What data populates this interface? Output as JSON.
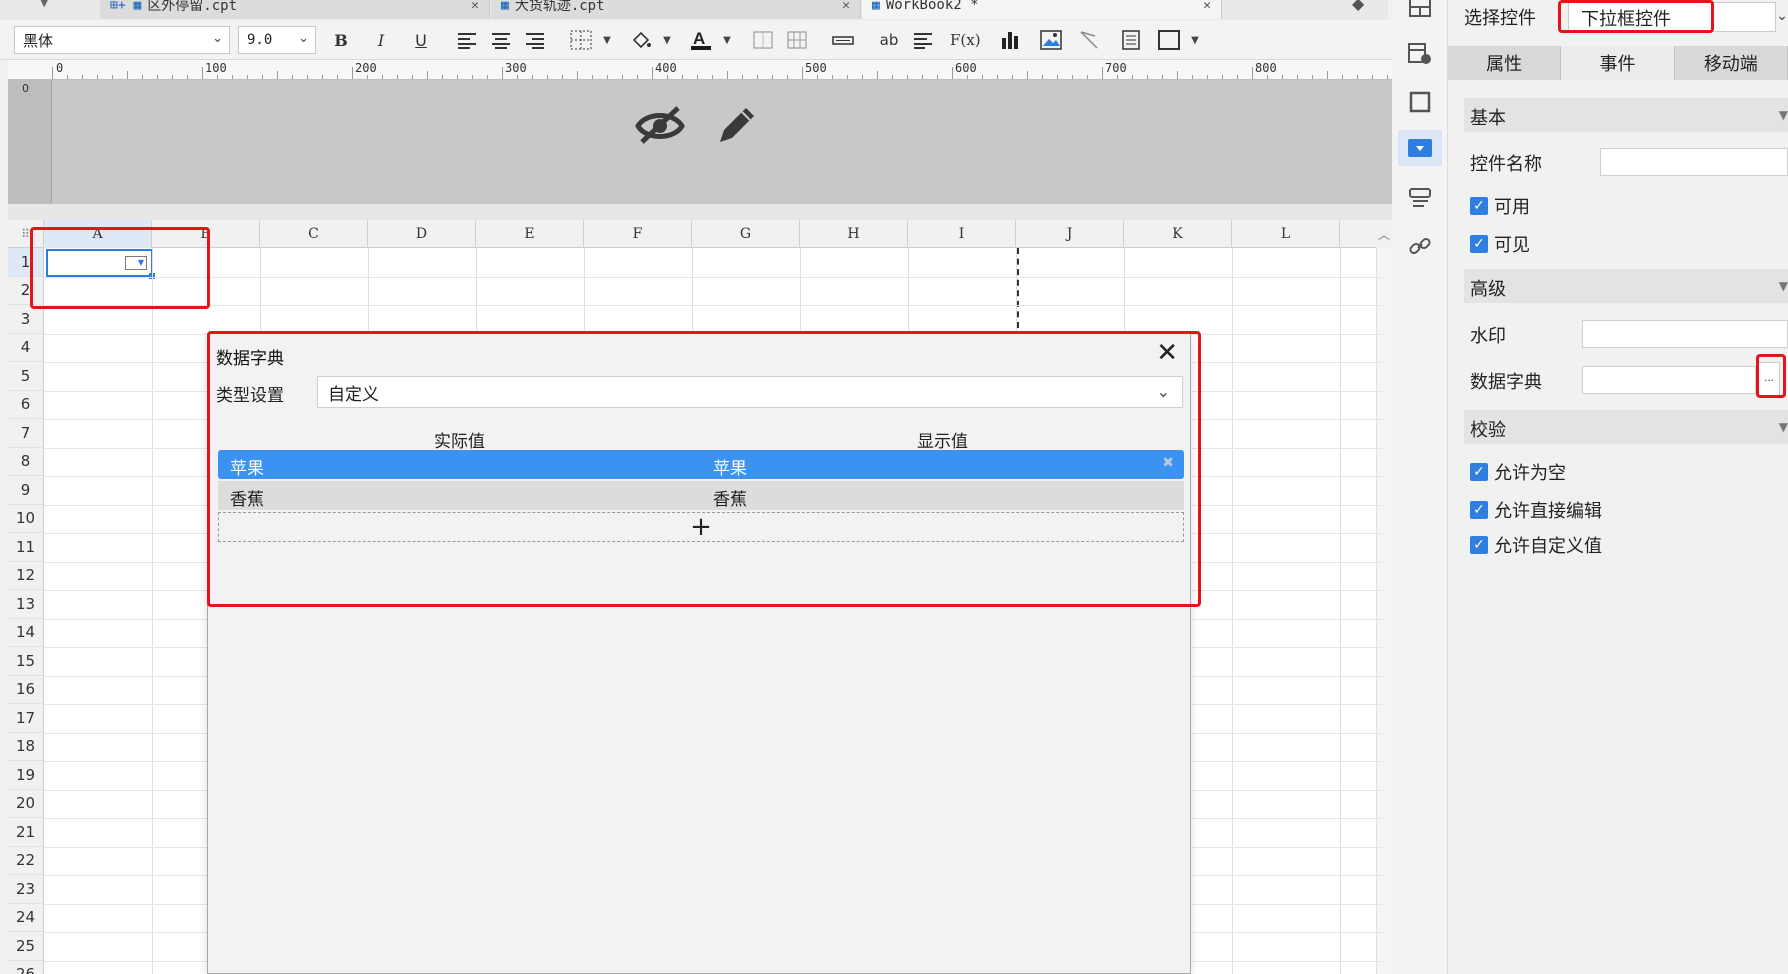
{
  "tabs": [
    {
      "label": "区外停留.cpt",
      "active": false
    },
    {
      "label": "大货轨迹.cpt",
      "active": false
    },
    {
      "label": "WorkBook2 *",
      "active": true
    }
  ],
  "toolbar": {
    "font_family": "黑体",
    "font_size": "9.0",
    "bold_label": "B",
    "italic_label": "I",
    "underline_label": "U",
    "text_tool_label": "ab",
    "formula_label": "F(x)",
    "text_color": "#1a1a1a"
  },
  "ruler": {
    "marks": [
      "0",
      "100",
      "200",
      "300",
      "400",
      "500",
      "600",
      "700",
      "800"
    ],
    "vertical_zero": "0"
  },
  "grid": {
    "columns": [
      "A",
      "B",
      "C",
      "D",
      "E",
      "F",
      "G",
      "H",
      "I",
      "J",
      "K",
      "L"
    ],
    "rows": [
      "1",
      "2",
      "3",
      "4",
      "5",
      "6",
      "7",
      "8",
      "9",
      "10",
      "11",
      "12",
      "13",
      "14",
      "15",
      "16",
      "17",
      "18",
      "19",
      "20",
      "21",
      "22",
      "23",
      "24",
      "25",
      "26"
    ],
    "selected_cell": "A1"
  },
  "dialog": {
    "title": "数据字典",
    "close_icon": "✕",
    "type_label": "类型设置",
    "type_value": "自定义",
    "col_actual": "实际值",
    "col_display": "显示值",
    "rows": [
      {
        "actual": "苹果",
        "display": "苹果",
        "selected": true
      },
      {
        "actual": "香蕉",
        "display": "香蕉",
        "selected": false
      }
    ],
    "add_label": "+"
  },
  "props": {
    "select_label": "选择控件",
    "select_value": "下拉框控件",
    "tabs": [
      "属性",
      "事件",
      "移动端"
    ],
    "active_tab": "属性",
    "basic_section": "基本",
    "name_label": "控件名称",
    "name_value": "",
    "enabled_label": "可用",
    "visible_label": "可见",
    "advanced_section": "高级",
    "watermark_label": "水印",
    "dict_label": "数据字典",
    "dict_button": "...",
    "validate_section": "校验",
    "allow_empty": "允许为空",
    "allow_edit": "允许直接编辑",
    "allow_custom": "允许自定义值"
  },
  "colors": {
    "accent": "#2f7fe0",
    "highlight": "#e5141b",
    "selection": "#3b92f1"
  }
}
